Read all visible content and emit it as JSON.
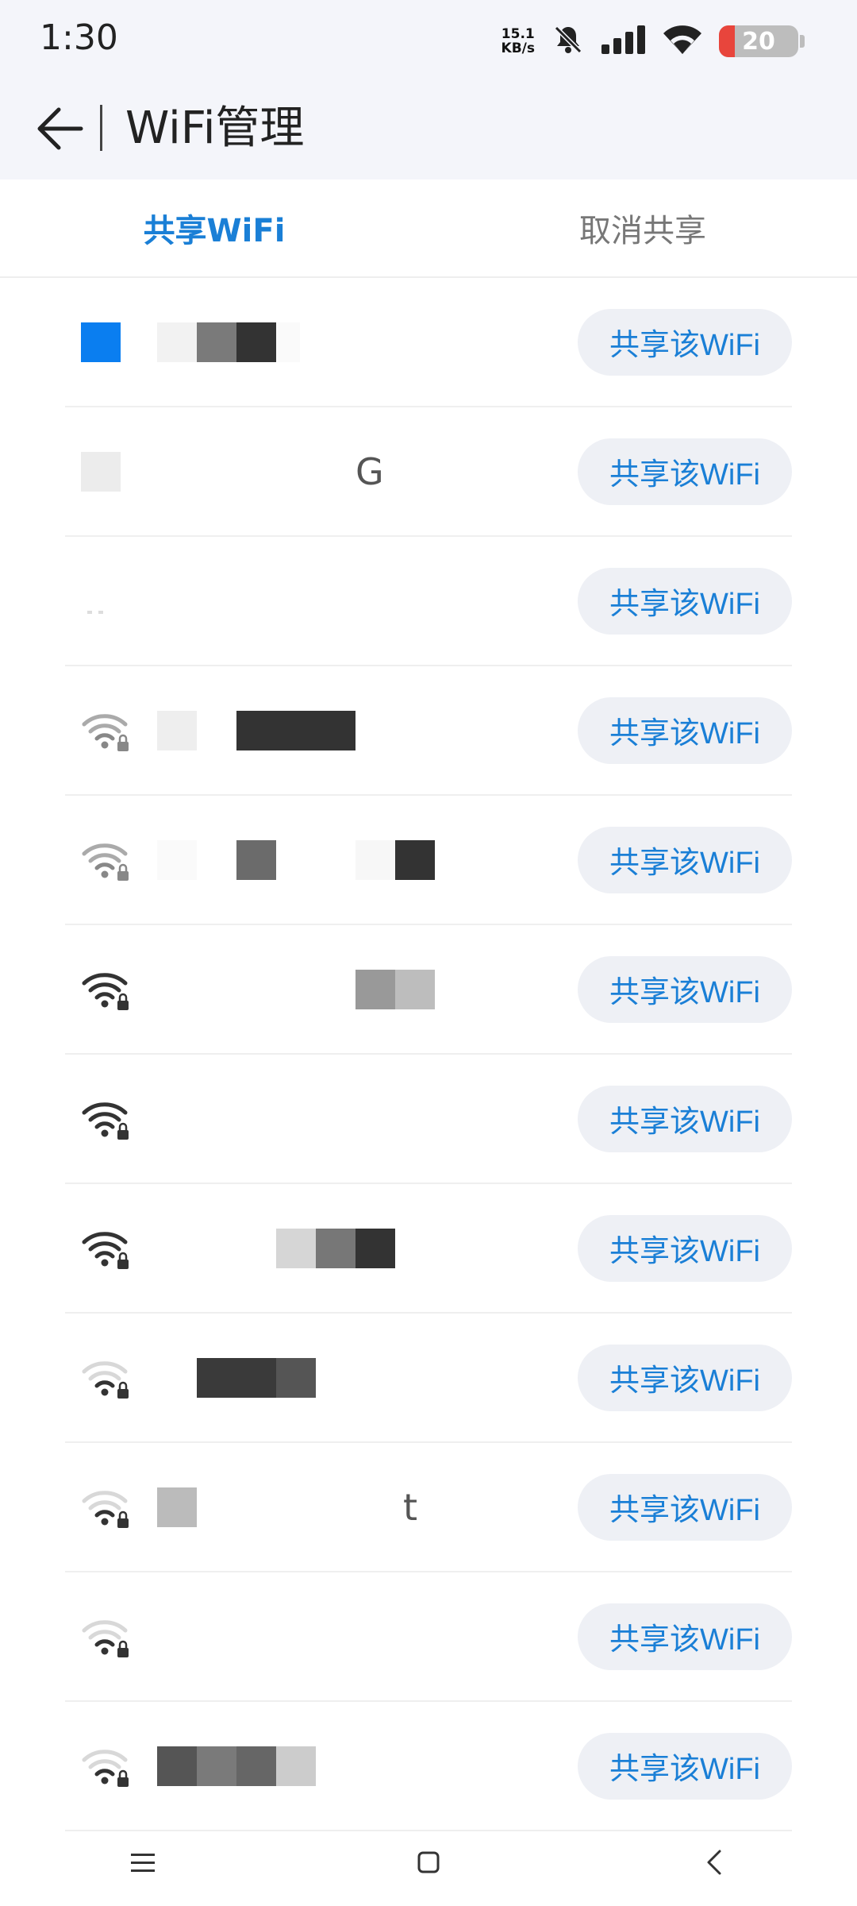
{
  "status": {
    "time": "1:30",
    "net_speed_value": "15.1",
    "net_speed_unit": "KB/s",
    "battery": "20",
    "icons": [
      "bell-off-icon",
      "signal-icon",
      "wifi-icon",
      "battery-icon"
    ]
  },
  "header": {
    "title": "WiFi管理",
    "back_icon": "arrow-left-icon"
  },
  "tabs": [
    {
      "label": "共享WiFi",
      "active": true
    },
    {
      "label": "取消共享",
      "active": false
    }
  ],
  "networks": [
    {
      "ssid_partial": "",
      "button": "共享该WiFi"
    },
    {
      "ssid_partial": "G",
      "button": "共享该WiFi"
    },
    {
      "ssid_partial": "",
      "button": "共享该WiFi"
    },
    {
      "ssid_partial": "",
      "button": "共享该WiFi"
    },
    {
      "ssid_partial": "",
      "button": "共享该WiFi"
    },
    {
      "ssid_partial": "",
      "button": "共享该WiFi"
    },
    {
      "ssid_partial": "",
      "button": "共享该WiFi"
    },
    {
      "ssid_partial": "",
      "button": "共享该WiFi"
    },
    {
      "ssid_partial": "",
      "button": "共享该WiFi"
    },
    {
      "ssid_partial": "t",
      "button": "共享该WiFi"
    },
    {
      "ssid_partial": "",
      "button": "共享该WiFi"
    },
    {
      "ssid_partial": "",
      "button": "共享该WiFi"
    }
  ],
  "nav": [
    "menu-icon",
    "home-icon",
    "back-icon"
  ],
  "colors": {
    "accent": "#1a7fd6",
    "button_bg": "#eef0f5",
    "header_bg": "#f4f5fa",
    "battery_low": "#e8453c"
  }
}
